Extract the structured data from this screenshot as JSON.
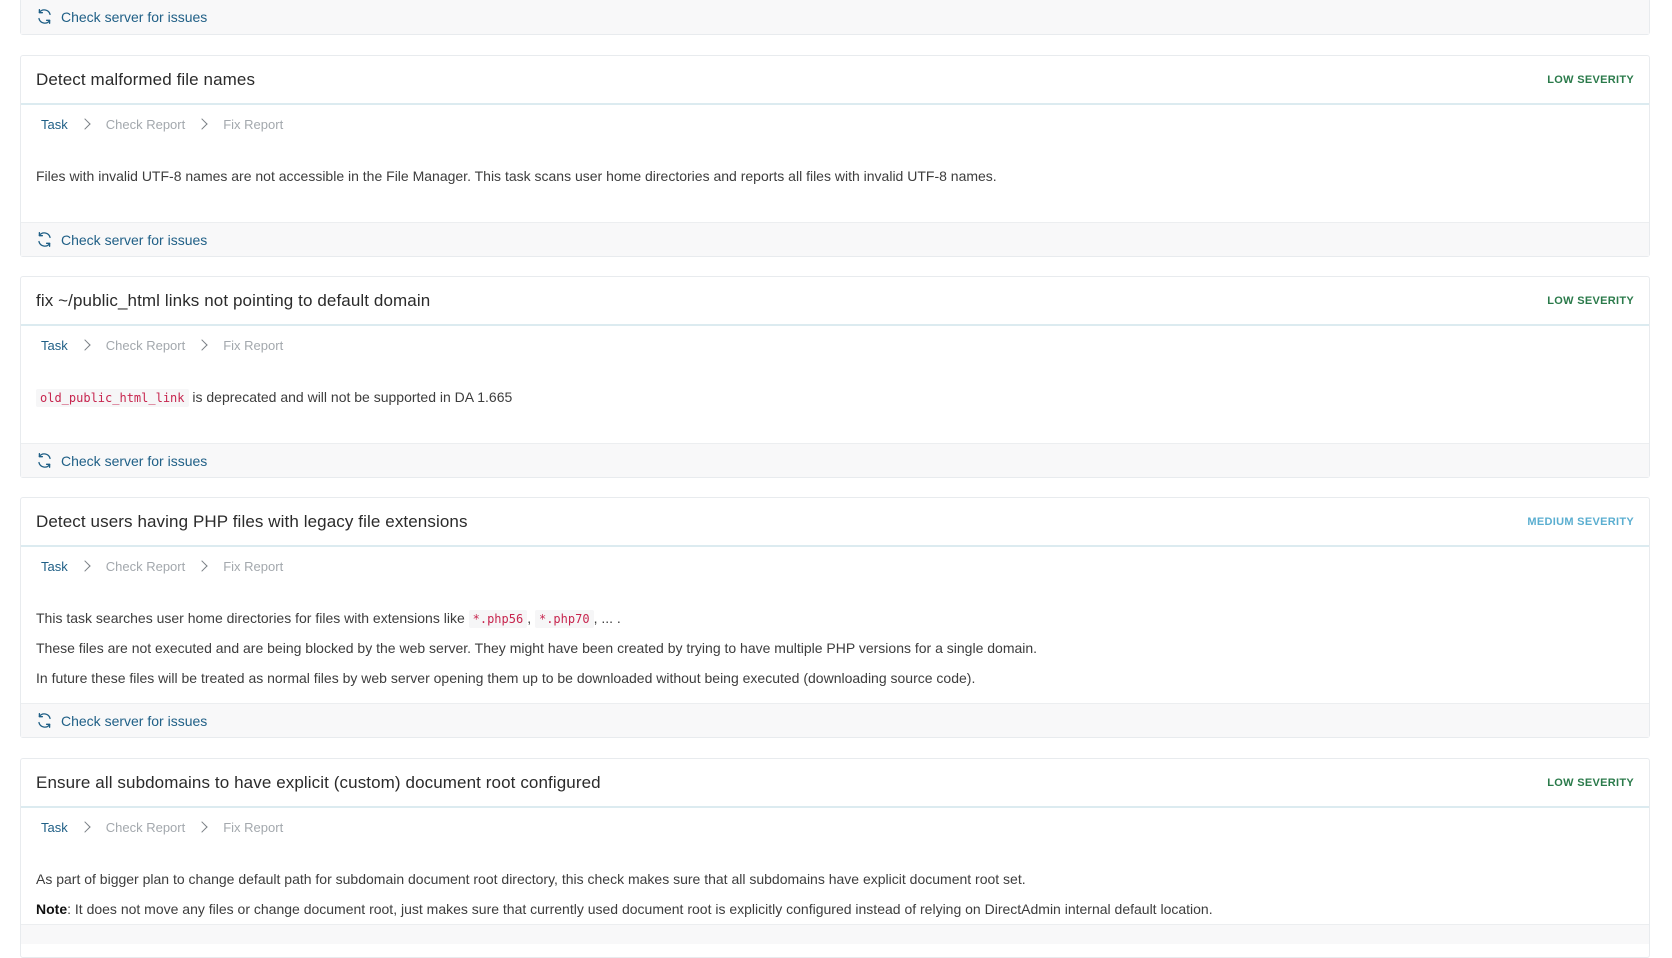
{
  "steps": [
    "Task",
    "Check Report",
    "Fix Report"
  ],
  "check_label": "Check server for issues",
  "top_footer": {
    "check_label": "Check server for issues"
  },
  "cards": [
    {
      "title": "Detect malformed file names",
      "severity": "LOW SEVERITY",
      "lines": [
        "Files with invalid UTF-8 names are not accessible in the File Manager. This task scans user home directories and reports all files with invalid UTF-8 names."
      ]
    },
    {
      "title": "fix ~/public_html links not pointing to default domain",
      "severity": "LOW SEVERITY",
      "code": "old_public_html_link",
      "line_after_code": "is deprecated and will not be supported in DA 1.665"
    },
    {
      "title": "Detect users having PHP files with legacy file extensions",
      "severity": "MEDIUM SEVERITY",
      "line1_prefix": "This task searches user home directories for files with extensions like",
      "code1": "*.php56",
      "sep": ",",
      "code2": "*.php70",
      "line1_suffix": ", ... .",
      "line2": "These files are not executed and are being blocked by the web server. They might have been created by trying to have multiple PHP versions for a single domain.",
      "line3": "In future these files will be treated as normal files by web server opening them up to be downloaded without being executed (downloading source code)."
    },
    {
      "title": "Ensure all subdomains to have explicit (custom) document root configured",
      "severity": "LOW SEVERITY",
      "line1": "As part of bigger plan to change default path for subdomain document root directory, this check makes sure that all subdomains have explicit document root set.",
      "note_label": "Note",
      "note_text": ": It does not move any files or change document root, just makes sure that currently used document root is explicitly configured instead of relying on DirectAdmin internal default location."
    }
  ],
  "colors": {
    "link": "#1f5f86",
    "low_severity": "#2a7a4a",
    "medium_severity": "#5aaed0",
    "code": "#c7254e"
  }
}
